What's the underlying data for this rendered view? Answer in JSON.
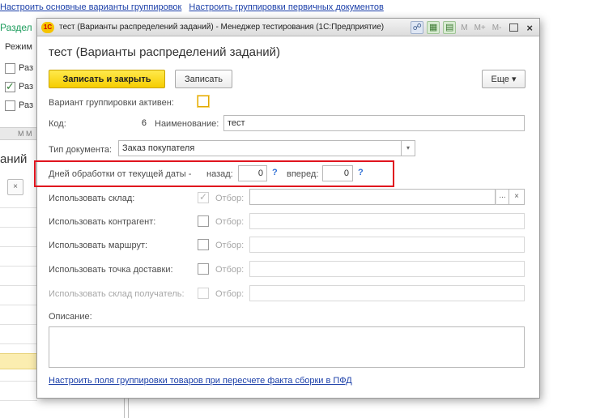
{
  "background": {
    "link_variants": "Настроить основные варианты группировок",
    "link_primary": "Настроить группировки первичных документов",
    "section_label": "Раздел",
    "mode_label": "Режим",
    "cb_label_1": "Раз",
    "cb_label_2": "Раз",
    "cb_label_3": "Раз",
    "strip_text": "M M",
    "heading": "аний",
    "clear_glyph": "×"
  },
  "window": {
    "app_icon": "1С",
    "title": "тест (Варианты распределений заданий) - Менеджер тестирования (1С:Предприятие)",
    "m_label": "M",
    "mplus_label": "M+",
    "mminus_label": "M-",
    "close_glyph": "×"
  },
  "form": {
    "title": "тест (Варианты распределений заданий)",
    "save_close_label": "Записать и закрыть",
    "save_label": "Записать",
    "more_label": "Еще ▾",
    "active_label": "Вариант группировки активен:",
    "code_label": "Код:",
    "code_value": "6",
    "name_label": "Наименование:",
    "name_value": "тест",
    "doctype_label": "Тип документа:",
    "doctype_value": "Заказ покупателя",
    "days_label": "Дней обработки от текущей даты -",
    "back_label": "назад:",
    "back_value": "0",
    "forward_label": "вперед:",
    "forward_value": "0",
    "help_glyph": "?",
    "filter_label": "Отбор:",
    "use_warehouse_label": "Использовать склад:",
    "use_contractor_label": "Использовать контрагент:",
    "use_route_label": "Использовать маршрут:",
    "use_delivery_label": "Использовать точка доставки:",
    "use_recv_label": "Использовать склад получатель:",
    "description_label": "Описание:",
    "bottom_link": "Настроить поля группировки товаров при пересчете факта сборки в ПФД",
    "select_glyph": "...",
    "clear_glyph": "×",
    "dropdown_glyph": "▾"
  },
  "colors": {
    "accent_yellow": "#f6cd00",
    "highlight_red": "#e0141e",
    "link_blue": "#1a3ea8"
  }
}
